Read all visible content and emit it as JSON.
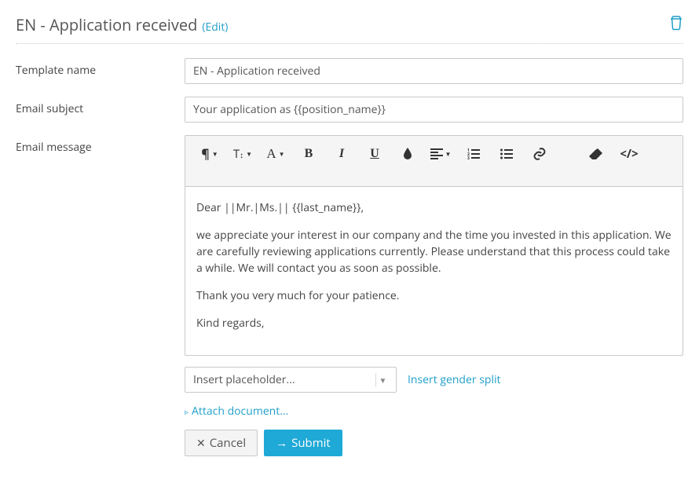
{
  "header": {
    "title": "EN - Application received",
    "edit_label": "(Edit)"
  },
  "fields": {
    "template_name_label": "Template name",
    "template_name_value": "EN - Application received",
    "email_subject_label": "Email subject",
    "email_subject_value": "Your application as {{position_name}}",
    "email_message_label": "Email message"
  },
  "message": {
    "greeting": "Dear ||Mr.|Ms.|| {{last_name}},",
    "para1": "we appreciate your interest in our company and the time you invested in this application. We are carefully reviewing applications currently. Please understand that this process could take a while. We will contact you as soon as possible.",
    "para2": "Thank you very much for your patience.",
    "signoff": "Kind regards,"
  },
  "placeholder": {
    "dropdown_label": "Insert placeholder...",
    "gender_split_label": "Insert gender split",
    "attach_label": "Attach document..."
  },
  "buttons": {
    "cancel": "Cancel",
    "submit": "Submit"
  },
  "toolbar": {
    "paragraph": "¶",
    "textsize_symbol": "T",
    "fontcolor": "A",
    "bold": "B",
    "italic": "I",
    "underline": "U"
  }
}
